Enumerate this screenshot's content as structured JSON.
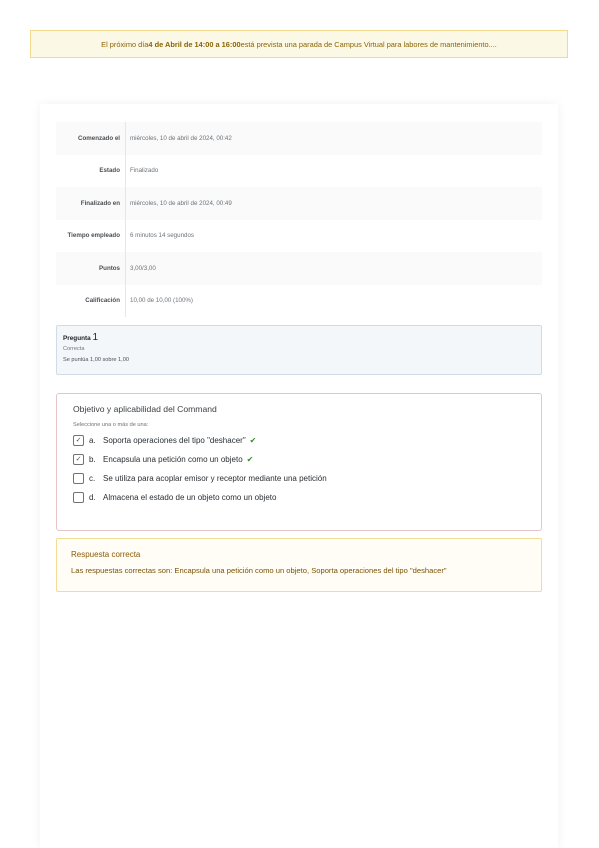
{
  "banner": {
    "prefix": "El próximo día ",
    "highlight": "4 de Abril de 14:00 a 16:00",
    "suffix": " está prevista una parada de Campus Virtual para labores de mantenimiento...."
  },
  "summary": {
    "rows": [
      {
        "label": "Comenzado el",
        "value": "miércoles, 10 de abril de 2024, 00:42"
      },
      {
        "label": "Estado",
        "value": "Finalizado"
      },
      {
        "label": "Finalizado en",
        "value": "miércoles, 10 de abril de 2024, 00:49"
      },
      {
        "label": "Tiempo empleado",
        "value": "6 minutos 14 segundos"
      },
      {
        "label": "Puntos",
        "value": "3,00/3,00"
      },
      {
        "label": "Calificación",
        "value": "10,00 de 10,00 (100%)"
      }
    ]
  },
  "question": {
    "title": "Pregunta",
    "number": "1",
    "state": "Correcta",
    "grade": "Se puntúa 1,00 sobre 1,00",
    "text": "Objetivo y aplicabilidad del Command",
    "prompt": "Seleccione una o más de una:",
    "options": [
      {
        "letter": "a.",
        "text": "Soporta operaciones del tipo \"deshacer\"",
        "checked": true,
        "correct": true
      },
      {
        "letter": "b.",
        "text": "Encapsula una petición como un objeto",
        "checked": true,
        "correct": true
      },
      {
        "letter": "c.",
        "text": "Se utiliza para acoplar emisor y receptor mediante una petición",
        "checked": false,
        "correct": false
      },
      {
        "letter": "d.",
        "text": "Almacena el estado de un objeto como un objeto",
        "checked": false,
        "correct": false
      }
    ]
  },
  "feedback": {
    "title": "Respuesta correcta",
    "text": "Las respuestas correctas son: Encapsula una petición como un objeto, Soporta operaciones del tipo \"deshacer\""
  },
  "icons": {
    "checkbox_checked": "checkbox-checked-icon",
    "correct_mark": "check-icon"
  },
  "colors": {
    "banner_bg": "#fcf8e6",
    "banner_text": "#8a6404",
    "correct_green": "#3a8a2e",
    "feedback_text": "#8a5a06"
  }
}
